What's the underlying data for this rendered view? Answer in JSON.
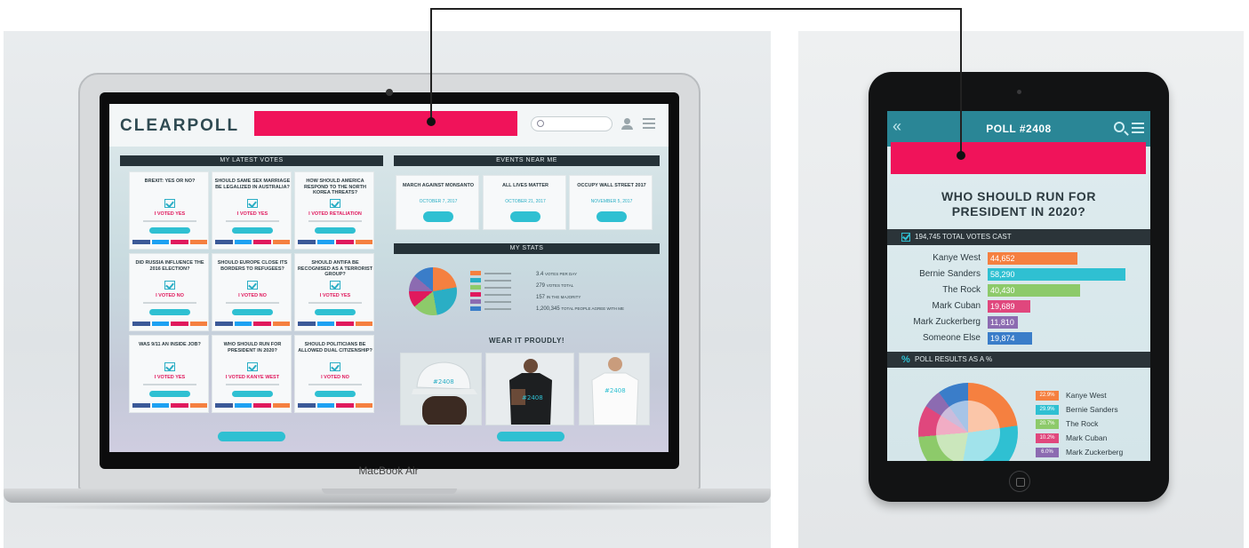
{
  "laptop": {
    "brand_label": "MacBook Air",
    "app": {
      "logo": "CLEARPOLL",
      "panels": {
        "latest_votes": "MY LATEST VOTES",
        "events": "EVENTS NEAR ME",
        "stats": "MY STATS",
        "merch": "WEAR IT PROUDLY!"
      },
      "vote_cards": [
        {
          "question": "BREXIT: YES OR NO?",
          "voted": "I VOTED YES"
        },
        {
          "question": "SHOULD SAME SEX MARRIAGE BE LEGALIZED IN AUSTRALIA?",
          "voted": "I VOTED YES"
        },
        {
          "question": "HOW SHOULD AMERICA RESPOND TO THE NORTH KOREA THREATS?",
          "voted": "I VOTED RETALIATION"
        },
        {
          "question": "DID RUSSIA INFLUENCE THE 2016 ELECTION?",
          "voted": "I VOTED NO"
        },
        {
          "question": "SHOULD EUROPE CLOSE ITS BORDERS TO REFUGEES?",
          "voted": "I VOTED NO"
        },
        {
          "question": "SHOULD ANTIFA BE RECOGNISED AS A TERRORIST GROUP?",
          "voted": "I VOTED YES"
        },
        {
          "question": "WAS 9/11 AN INSIDE JOB?",
          "voted": "I VOTED YES"
        },
        {
          "question": "WHO SHOULD RUN FOR PRESIDENT IN 2020?",
          "voted": "I VOTED KANYE WEST"
        },
        {
          "question": "SHOULD POLITICIANS BE ALLOWED DUAL CITIZENSHIP?",
          "voted": "I VOTED NO"
        }
      ],
      "events": [
        {
          "title": "MARCH AGAINST MONSANTO",
          "date": "OCTOBER 7, 2017"
        },
        {
          "title": "ALL LIVES MATTER",
          "date": "OCTOBER 21, 2017"
        },
        {
          "title": "OCCUPY WALL STREET 2017",
          "date": "NOVEMBER 5, 2017"
        }
      ],
      "stats": [
        {
          "value": "3.4",
          "label": "VOTES PER DAY"
        },
        {
          "value": "279",
          "label": "VOTES TOTAL"
        },
        {
          "value": "157",
          "label": "IN THE MAJORITY"
        },
        {
          "value": "1,200,345",
          "label": "TOTAL PEOPLE AGREE WITH ME"
        }
      ],
      "stats_legend_colors": [
        "#f58040",
        "#2aaec5",
        "#8dca6a",
        "#e0195d",
        "#8c6bb1",
        "#3a7dc9"
      ],
      "shirt_print": "#2408"
    }
  },
  "tablet": {
    "title": "POLL #2408",
    "back_icon": "«",
    "question": "WHO SHOULD RUN FOR PRESIDENT IN 2020?",
    "votes_cast": "194,745 TOTAL VOTES CAST",
    "results_label": "POLL RESULTS AS A %",
    "percent_icon": "%",
    "results": [
      {
        "name": "Kanye West",
        "votes": "44,652",
        "color": "#f58040",
        "fraction": 0.65
      },
      {
        "name": "Bernie Sanders",
        "votes": "58,290",
        "color": "#2fc0d2",
        "fraction": 1.0
      },
      {
        "name": "The Rock",
        "votes": "40,430",
        "color": "#8dca6a",
        "fraction": 0.67
      },
      {
        "name": "Mark Cuban",
        "votes": "19,689",
        "color": "#e0477d",
        "fraction": 0.31
      },
      {
        "name": "Mark Zuckerberg",
        "votes": "11,810",
        "color": "#8c6bb1",
        "fraction": 0.22
      },
      {
        "name": "Someone Else",
        "votes": "19,874",
        "color": "#3a7dc9",
        "fraction": 0.32
      }
    ],
    "percent_legend": [
      {
        "pct": "22.9%",
        "name": "Kanye West",
        "color": "#f58040"
      },
      {
        "pct": "29.9%",
        "name": "Bernie Sanders",
        "color": "#2fc0d2"
      },
      {
        "pct": "20.7%",
        "name": "The Rock",
        "color": "#8dca6a"
      },
      {
        "pct": "10.2%",
        "name": "Mark Cuban",
        "color": "#e0477d"
      },
      {
        "pct": "6.0%",
        "name": "Mark Zuckerberg",
        "color": "#8c6bb1"
      }
    ]
  },
  "redaction_color": "#f0135a"
}
